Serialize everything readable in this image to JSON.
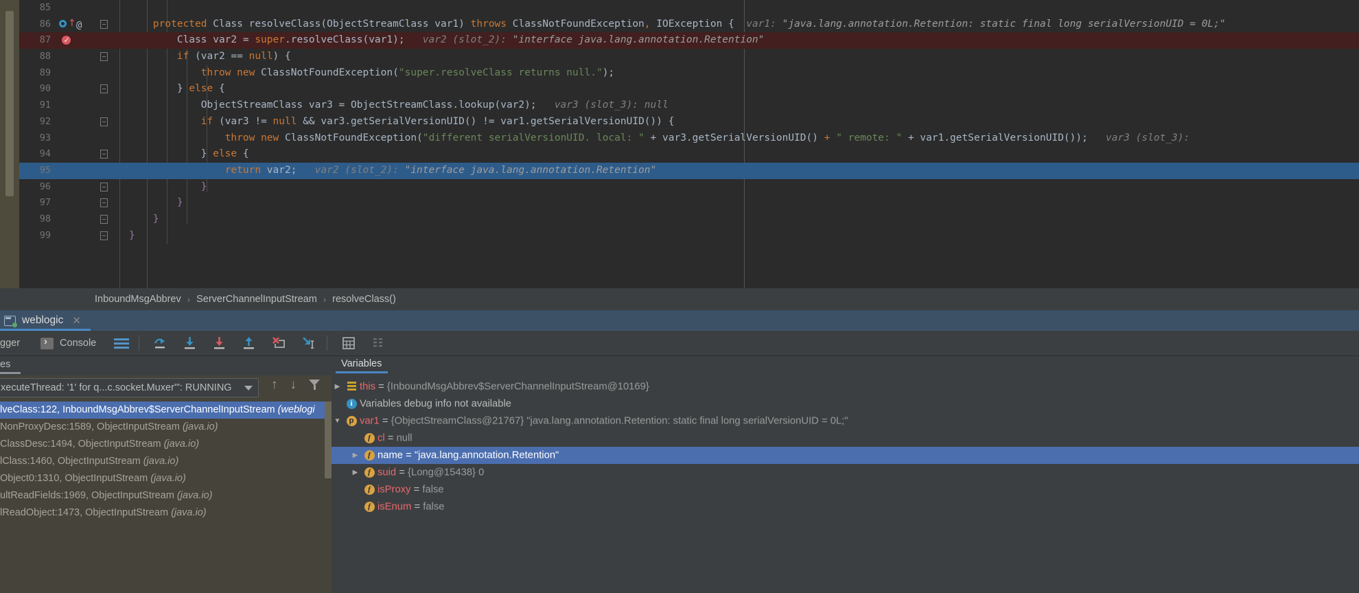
{
  "editor": {
    "lines": [
      {
        "num": "85",
        "segments": []
      },
      {
        "num": "86",
        "segments": [
          {
            "t": "    ",
            "c": "id"
          },
          {
            "t": "protected ",
            "c": "kw"
          },
          {
            "t": "Class resolveClass(ObjectStreamClass var1) ",
            "c": "id"
          },
          {
            "t": "throws ",
            "c": "kw"
          },
          {
            "t": "ClassNotFoundException",
            "c": "id"
          },
          {
            "t": ", ",
            "c": "kw"
          },
          {
            "t": "IOException {  ",
            "c": "id"
          },
          {
            "t": "var1: ",
            "c": "hint"
          },
          {
            "t": "\"java.lang.annotation.Retention: static final long serialVersionUID = 0L;\"",
            "c": "hint-str"
          }
        ]
      },
      {
        "num": "87",
        "segments": [
          {
            "t": "        Class var2 = ",
            "c": "id"
          },
          {
            "t": "super",
            "c": "kw"
          },
          {
            "t": ".resolveClass(var1);   ",
            "c": "id"
          },
          {
            "t": "var2 (slot_2): ",
            "c": "hint"
          },
          {
            "t": "\"interface java.lang.annotation.Retention\"",
            "c": "hint-str"
          }
        ]
      },
      {
        "num": "88",
        "segments": [
          {
            "t": "        ",
            "c": "id"
          },
          {
            "t": "if ",
            "c": "kw"
          },
          {
            "t": "(var2 == ",
            "c": "id"
          },
          {
            "t": "null",
            "c": "kw"
          },
          {
            "t": ") {",
            "c": "id"
          }
        ]
      },
      {
        "num": "89",
        "segments": [
          {
            "t": "            ",
            "c": "id"
          },
          {
            "t": "throw new ",
            "c": "kw"
          },
          {
            "t": "ClassNotFoundException(",
            "c": "id"
          },
          {
            "t": "\"super.resolveClass returns null.\"",
            "c": "str"
          },
          {
            "t": ");",
            "c": "id"
          }
        ]
      },
      {
        "num": "90",
        "segments": [
          {
            "t": "        } ",
            "c": "id"
          },
          {
            "t": "else ",
            "c": "kw"
          },
          {
            "t": "{",
            "c": "id"
          }
        ]
      },
      {
        "num": "91",
        "segments": [
          {
            "t": "            ObjectStreamClass var3 = ObjectStreamClass.lookup(var2);   ",
            "c": "id"
          },
          {
            "t": "var3 (slot_3): null",
            "c": "hint"
          }
        ]
      },
      {
        "num": "92",
        "segments": [
          {
            "t": "            ",
            "c": "id"
          },
          {
            "t": "if ",
            "c": "kw"
          },
          {
            "t": "(var3 != ",
            "c": "id"
          },
          {
            "t": "null ",
            "c": "kw"
          },
          {
            "t": "&& var3.getSerialVersionUID() != var1.getSerialVersionUID()) {",
            "c": "id"
          }
        ]
      },
      {
        "num": "93",
        "segments": [
          {
            "t": "                ",
            "c": "id"
          },
          {
            "t": "throw new ",
            "c": "kw"
          },
          {
            "t": "ClassNotFoundException(",
            "c": "id"
          },
          {
            "t": "\"different serialVersionUID. local: \"",
            "c": "str"
          },
          {
            "t": " + var3.getSerialVersionUID() ",
            "c": "id"
          },
          {
            "t": "+ ",
            "c": "kw"
          },
          {
            "t": "\" remote: \"",
            "c": "str"
          },
          {
            "t": " + var1.getSerialVersionUID());   ",
            "c": "id"
          },
          {
            "t": "var3 (slot_3): ",
            "c": "hint"
          }
        ]
      },
      {
        "num": "94",
        "segments": [
          {
            "t": "            } ",
            "c": "id"
          },
          {
            "t": "else ",
            "c": "kw"
          },
          {
            "t": "{",
            "c": "id"
          }
        ]
      },
      {
        "num": "95",
        "selected": true,
        "segments": [
          {
            "t": "                ",
            "c": "id"
          },
          {
            "t": "return ",
            "c": "kw"
          },
          {
            "t": "var2;   ",
            "c": "id"
          },
          {
            "t": "var2 (slot_2): ",
            "c": "hint"
          },
          {
            "t": "\"interface java.lang.annotation.Retention\"",
            "c": "hint-str"
          }
        ]
      },
      {
        "num": "96",
        "segments": [
          {
            "t": "            }",
            "c": "brace-b"
          }
        ]
      },
      {
        "num": "97",
        "segments": [
          {
            "t": "        }",
            "c": "brace-b"
          }
        ]
      },
      {
        "num": "98",
        "segments": [
          {
            "t": "    }",
            "c": "brace-b"
          }
        ]
      },
      {
        "num": "99",
        "segments": [
          {
            "t": "}",
            "c": "brace-b"
          }
        ]
      }
    ],
    "breadcrumb": [
      {
        "label": "InboundMsgAbbrev"
      },
      {
        "label": "ServerChannelInputStream"
      },
      {
        "label": "resolveClass()"
      }
    ],
    "breadcrumb_separator": "›"
  },
  "debug": {
    "session": {
      "name": "weblogic",
      "close_label": "✕",
      "icon": "debug-session-icon"
    },
    "toolbar": {
      "debugger_tab_label": "gger",
      "console_tab_label": "Console",
      "icons": [
        "hamburger-icon",
        "step-over-icon",
        "step-into-icon",
        "force-step-into-icon",
        "step-out-icon",
        "drop-frame-icon",
        "run-to-cursor-icon",
        "evaluate-expression-icon",
        "settings-icon"
      ]
    },
    "frames": {
      "tab_label": "es",
      "thread": "xecuteThread: '1' for q...c.socket.Muxer'\": RUNNING",
      "nav_up": "↑",
      "nav_down": "↓",
      "rows": [
        {
          "text": "lveClass:122, InboundMsgAbbrev$ServerChannelInputStream ",
          "pkg": "(weblogi",
          "selected": true
        },
        {
          "text": "NonProxyDesc:1589, ObjectInputStream ",
          "pkg": "(java.io)"
        },
        {
          "text": "ClassDesc:1494, ObjectInputStream ",
          "pkg": "(java.io)"
        },
        {
          "text": "lClass:1460, ObjectInputStream ",
          "pkg": "(java.io)"
        },
        {
          "text": "Object0:1310, ObjectInputStream ",
          "pkg": "(java.io)"
        },
        {
          "text": "ultReadFields:1969, ObjectInputStream ",
          "pkg": "(java.io)"
        },
        {
          "text": "lReadObject:1473, ObjectInputStream ",
          "pkg": "(java.io)"
        }
      ]
    },
    "variables": {
      "tab_label": "Variables",
      "rows": [
        {
          "toggle": "collapsed",
          "icon": "stack-frame-icon",
          "indent": 0,
          "name": "this",
          "name_color": "red",
          "eq": " = ",
          "value": "{InboundMsgAbbrev$ServerChannelInputStream@10169}"
        },
        {
          "toggle": "none",
          "icon": "info-icon",
          "indent": 0,
          "name": "Variables debug info not available",
          "name_color": "plain",
          "eq": "",
          "value": ""
        },
        {
          "toggle": "expanded",
          "icon": "object-icon",
          "indent": 0,
          "name": "var1",
          "name_color": "red",
          "eq": " = ",
          "value": "{ObjectStreamClass@21767} \"java.lang.annotation.Retention: static final long serialVersionUID = 0L;\""
        },
        {
          "toggle": "none",
          "icon": "field-icon",
          "indent": 1,
          "name": "cl",
          "name_color": "red",
          "eq": " = ",
          "value": "null"
        },
        {
          "toggle": "collapsed",
          "icon": "field-icon",
          "indent": 1,
          "name": "name",
          "name_color": "red",
          "eq": " = ",
          "value": "\"java.lang.annotation.Retention\"",
          "selected": true
        },
        {
          "toggle": "collapsed",
          "icon": "field-icon",
          "indent": 1,
          "name": "suid",
          "name_color": "red",
          "eq": " = ",
          "value": "{Long@15438} 0"
        },
        {
          "toggle": "none",
          "icon": "field-icon",
          "indent": 1,
          "name": "isProxy",
          "name_color": "red",
          "eq": " = ",
          "value": "false"
        },
        {
          "toggle": "none",
          "icon": "field-icon",
          "indent": 1,
          "name": "isEnum",
          "name_color": "red",
          "eq": " = ",
          "value": "false"
        }
      ]
    }
  },
  "colors": {
    "editor_bg": "#2B2B2B",
    "panel_bg": "#3C3F41",
    "selection_blue": "#2E5C8A",
    "tree_selection": "#4B6EAF",
    "breakpoint_red": "#DB5860",
    "accent_blue": "#4A88C7",
    "frames_bg": "#45433A",
    "keyword_orange": "#CC7832",
    "string_green": "#6A8759",
    "identifier": "#A9B7C6"
  }
}
